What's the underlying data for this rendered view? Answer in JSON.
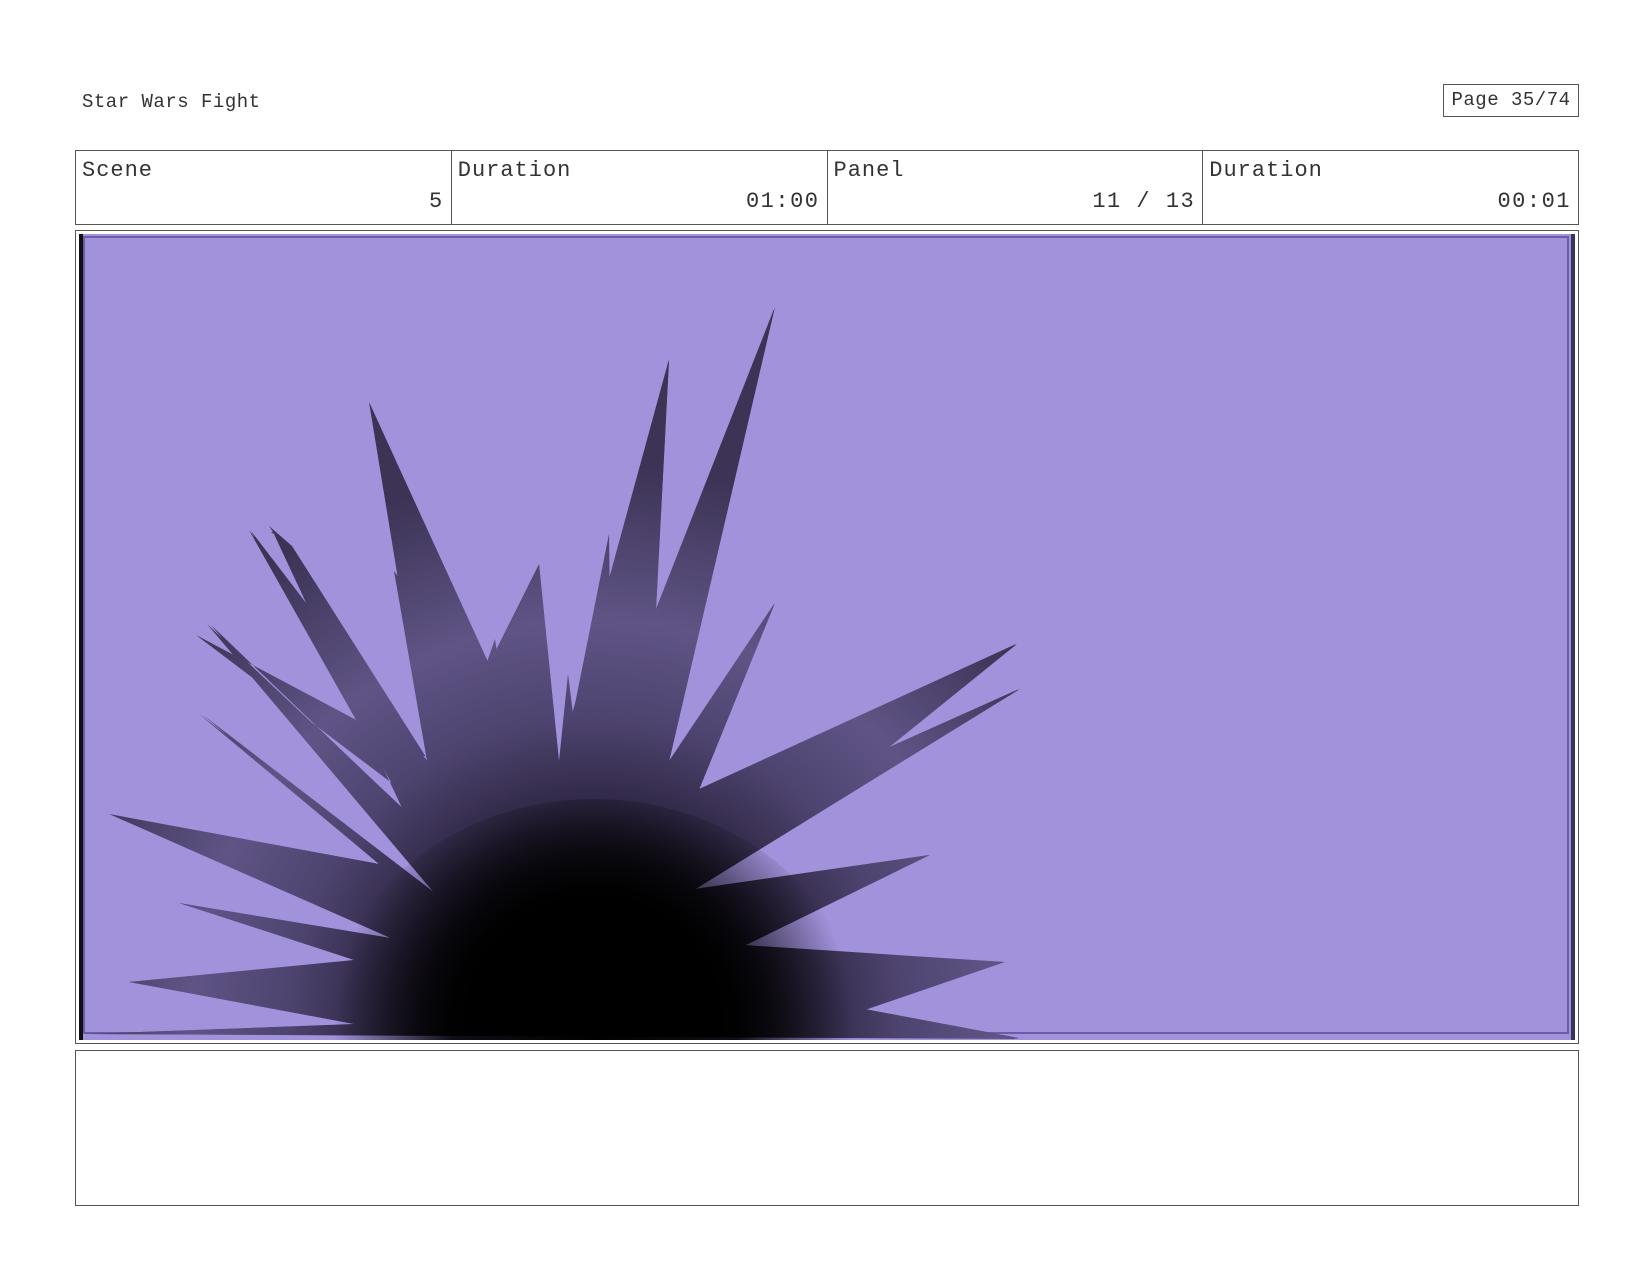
{
  "header": {
    "project_title": "Star Wars Fight",
    "page_label": "Page 35/74"
  },
  "info": {
    "scene_label": "Scene",
    "scene_value": "5",
    "scene_duration_label": "Duration",
    "scene_duration_value": "01:00",
    "panel_label": "Panel",
    "panel_value": "11 / 13",
    "panel_duration_label": "Duration",
    "panel_duration_value": "00:01"
  },
  "panel": {
    "background_color": "#a291db",
    "burst_color": "#4a3f68",
    "core_color": "#000000"
  },
  "notes": {
    "text": ""
  }
}
